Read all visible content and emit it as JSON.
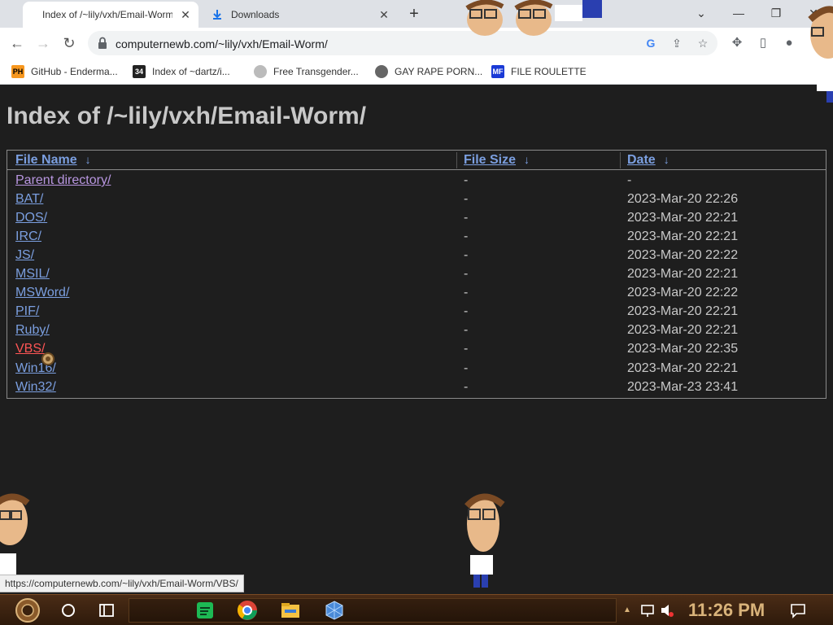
{
  "browser": {
    "tabs": [
      {
        "title": "Index of /~lily/vxh/Email-Worm/",
        "close_glyph": "✕"
      },
      {
        "title": "Downloads",
        "close_glyph": "✕"
      }
    ],
    "new_tab_glyph": "+",
    "url": "computernewb.com/~lily/vxh/Email-Worm/",
    "bookmarks": [
      {
        "label": "GitHub - Enderma...",
        "icon": "PH"
      },
      {
        "label": "Index of ~dartz/i...",
        "icon": "34"
      },
      {
        "label": "Free Transgender...",
        "icon": ""
      },
      {
        "label": "GAY RAPE PORN...",
        "icon": ""
      },
      {
        "label": "FILE ROULETTE",
        "icon": "MF"
      }
    ]
  },
  "page": {
    "title": "Index of /~lily/vxh/Email-Worm/",
    "headers": {
      "name": "File Name",
      "size": "File Size",
      "date": "Date",
      "sort_glyph": "↓"
    },
    "rows": [
      {
        "name": "Parent directory/",
        "size": "-",
        "date": "-"
      },
      {
        "name": "BAT/",
        "size": "-",
        "date": "2023-Mar-20 22:26"
      },
      {
        "name": "DOS/",
        "size": "-",
        "date": "2023-Mar-20 22:21"
      },
      {
        "name": "IRC/",
        "size": "-",
        "date": "2023-Mar-20 22:21"
      },
      {
        "name": "JS/",
        "size": "-",
        "date": "2023-Mar-20 22:22"
      },
      {
        "name": "MSIL/",
        "size": "-",
        "date": "2023-Mar-20 22:21"
      },
      {
        "name": "MSWord/",
        "size": "-",
        "date": "2023-Mar-20 22:22"
      },
      {
        "name": "PIF/",
        "size": "-",
        "date": "2023-Mar-20 22:21"
      },
      {
        "name": "Ruby/",
        "size": "-",
        "date": "2023-Mar-20 22:21"
      },
      {
        "name": "VBS/",
        "size": "-",
        "date": "2023-Mar-20 22:35"
      },
      {
        "name": "Win16/",
        "size": "-",
        "date": "2023-Mar-20 22:21"
      },
      {
        "name": "Win32/",
        "size": "-",
        "date": "2023-Mar-23 23:41"
      }
    ],
    "status_url": "https://computernewb.com/~lily/vxh/Email-Worm/VBS/"
  },
  "taskbar": {
    "clock": "11:26 PM"
  },
  "colors": {
    "link": "#7b9fe0",
    "visited": "#b896e0",
    "hover": "#ff5555",
    "page_bg": "#1e1e1e",
    "text": "#c8c8c8"
  }
}
